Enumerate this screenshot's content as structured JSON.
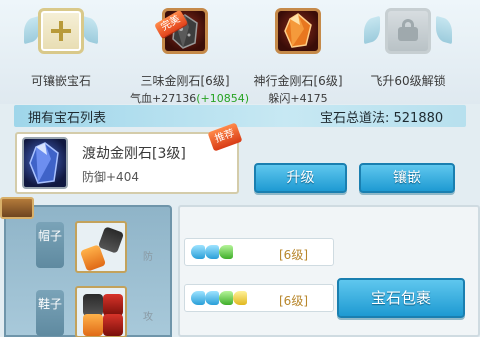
{
  "slots": [
    {
      "name": "可镶嵌宝石",
      "attr": "",
      "attr_bonus": "",
      "state": "empty",
      "icon": "plus-icon"
    },
    {
      "name": "三味金刚石[6级]",
      "attr": "气血+27136",
      "attr_bonus": "(+10854)",
      "state": "filled",
      "badge": "完美",
      "icon": "dark-diamond-gem-icon"
    },
    {
      "name": "神行金刚石[6级]",
      "attr": "躲闪+4175",
      "attr_bonus": "",
      "state": "filled",
      "icon": "orange-diamond-gem-icon"
    },
    {
      "name": "飞升60级解锁",
      "attr": "",
      "attr_bonus": "",
      "state": "locked",
      "icon": "lock-icon"
    }
  ],
  "owned": {
    "title": "拥有宝石列表",
    "total_power": "宝石总道法: 521880"
  },
  "selected_gem": {
    "name": "渡劫金刚石[3级]",
    "attr": "防御+404",
    "badge": "推荐",
    "icon": "blue-diamond-gem-icon"
  },
  "buttons": {
    "upgrade": "升级",
    "inlay": "镶嵌",
    "gem_bag": "宝石包裹"
  },
  "equipment": [
    {
      "label": "帽子",
      "side": "防"
    },
    {
      "label": "鞋子",
      "side": "攻"
    }
  ],
  "gem_rows": [
    {
      "level": "[6级]"
    },
    {
      "level": "[6级]"
    }
  ],
  "colors": {
    "button_blue": "#1e9ad2",
    "bonus_green": "#27a323",
    "level_gold": "#b8872c",
    "badge_orange": "#e2421b"
  }
}
